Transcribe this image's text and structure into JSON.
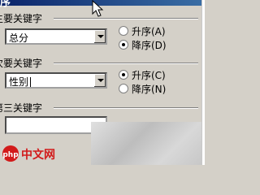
{
  "window": {
    "title": "序"
  },
  "primary": {
    "label": "主要关键字",
    "value": "总分",
    "ascending_label": "升序(A)",
    "descending_label": "降序(D)",
    "selected": "descending"
  },
  "secondary": {
    "label": "次要关键字",
    "value": "性别",
    "ascending_label": "升序(C)",
    "descending_label": "降序(N)",
    "selected": "ascending"
  },
  "tertiary": {
    "label": "第三关键字",
    "value": ""
  },
  "watermark": {
    "text": "php中文网"
  },
  "colors": {
    "watermark_red": "#d21a1a",
    "title_blue": "#0a246a"
  }
}
